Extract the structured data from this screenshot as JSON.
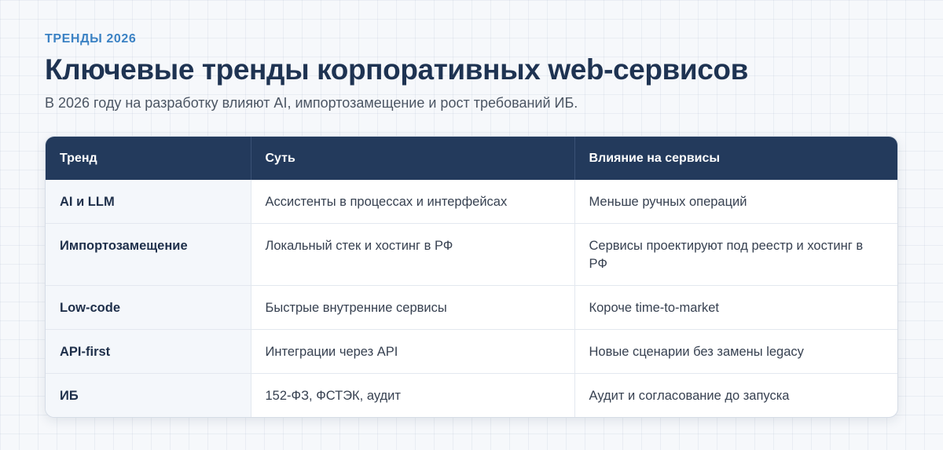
{
  "header": {
    "eyebrow": "ТРЕНДЫ 2026",
    "title": "Ключевые тренды корпоративных web-сервисов",
    "subtitle": "В 2026 году на разработку влияют AI, импортозамещение и рост требований ИБ."
  },
  "table": {
    "columns": [
      "Тренд",
      "Суть",
      "Влияние на сервисы"
    ],
    "rows": [
      [
        "AI и LLM",
        "Ассистенты в процессах и интерфейсах",
        "Меньше ручных операций"
      ],
      [
        "Импортозамещение",
        "Локальный стек и хостинг в РФ",
        "Сервисы проектируют под реестр и хостинг в РФ"
      ],
      [
        "Low-code",
        "Быстрые внутренние сервисы",
        "Короче time-to-market"
      ],
      [
        "API-first",
        "Интеграции через API",
        "Новые сценарии без замены legacy"
      ],
      [
        "ИБ",
        "152-ФЗ, ФСТЭК, аудит",
        "Аудит и согласование до запуска"
      ]
    ]
  }
}
